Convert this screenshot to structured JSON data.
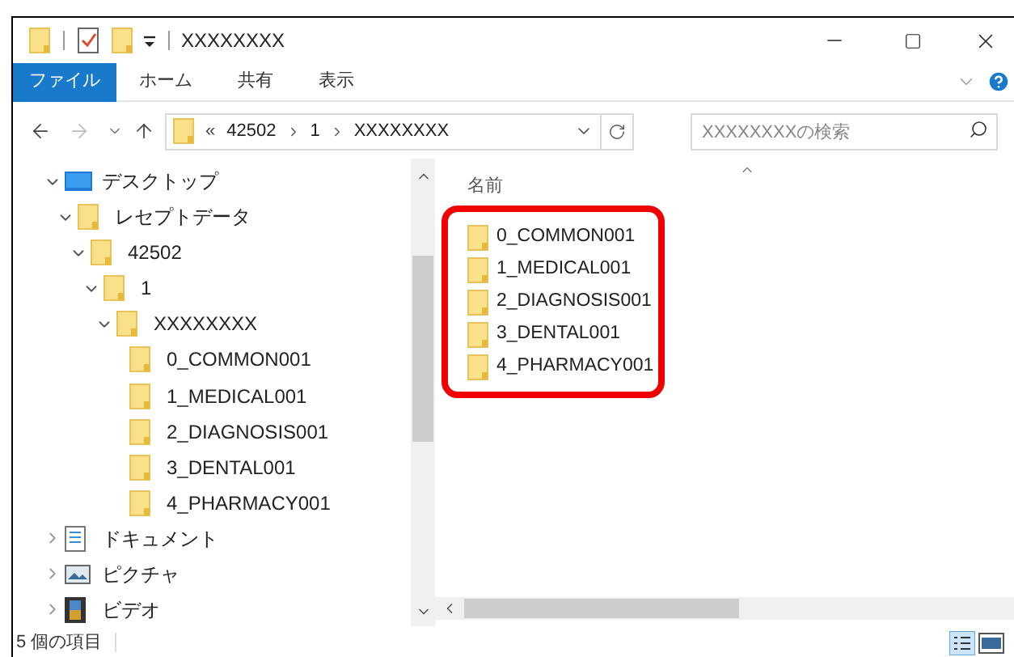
{
  "window": {
    "title": "XXXXXXXX"
  },
  "ribbon_tabs": [
    {
      "label": "ファイル",
      "selected": true
    },
    {
      "label": "ホーム",
      "selected": false
    },
    {
      "label": "共有",
      "selected": false
    },
    {
      "label": "表示",
      "selected": false
    }
  ],
  "address_bar": {
    "overflow": "«",
    "crumbs": [
      "42502",
      "1",
      "XXXXXXXX"
    ]
  },
  "search": {
    "placeholder": "XXXXXXXXの検索"
  },
  "navigation": {
    "forward_disabled": true
  },
  "tree": [
    {
      "label": "デスクトップ",
      "kind": "desktop",
      "expanded": true,
      "children": [
        {
          "label": "レセプトデータ",
          "kind": "folder",
          "expanded": true,
          "children": [
            {
              "label": "42502",
              "kind": "folder",
              "expanded": true,
              "children": [
                {
                  "label": "1",
                  "kind": "folder",
                  "expanded": true,
                  "children": [
                    {
                      "label": "XXXXXXXX",
                      "kind": "folder",
                      "expanded": true,
                      "children": [
                        {
                          "label": "0_COMMON001",
                          "kind": "folder"
                        },
                        {
                          "label": "1_MEDICAL001",
                          "kind": "folder"
                        },
                        {
                          "label": "2_DIAGNOSIS001",
                          "kind": "folder"
                        },
                        {
                          "label": "3_DENTAL001",
                          "kind": "folder"
                        },
                        {
                          "label": "4_PHARMACY001",
                          "kind": "folder"
                        }
                      ]
                    }
                  ]
                }
              ]
            }
          ]
        }
      ]
    },
    {
      "label": "ドキュメント",
      "kind": "documents",
      "expanded": false
    },
    {
      "label": "ピクチャ",
      "kind": "pictures",
      "expanded": false
    },
    {
      "label": "ビデオ",
      "kind": "videos",
      "expanded": false
    }
  ],
  "file_list": {
    "column": "名前",
    "items": [
      "0_COMMON001",
      "1_MEDICAL001",
      "2_DIAGNOSIS001",
      "3_DENTAL001",
      "4_PHARMACY001"
    ]
  },
  "status_bar": {
    "text": "5 個の項目"
  }
}
